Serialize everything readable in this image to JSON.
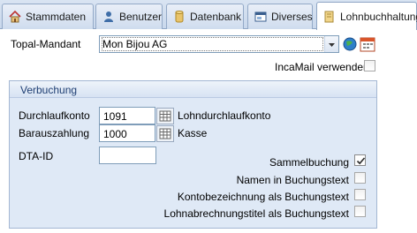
{
  "tabs": [
    {
      "label": "Stammdaten",
      "icon": "house-icon"
    },
    {
      "label": "Benutzer",
      "icon": "user-icon"
    },
    {
      "label": "Datenbank",
      "icon": "database-icon"
    },
    {
      "label": "Diverses",
      "icon": "window-icon"
    },
    {
      "label": "Lohnbuchhaltung",
      "icon": "book-icon",
      "active": true
    }
  ],
  "mandant": {
    "label": "Topal-Mandant",
    "value": "Mon Bijou AG"
  },
  "incamail": {
    "label": "IncaMail verwenden",
    "checked": false
  },
  "group": {
    "title": "Verbuchung",
    "durchlaufkonto": {
      "label": "Durchlaufkonto",
      "value": "1091",
      "description": "Lohndurchlaufkonto"
    },
    "barauszahlung": {
      "label": "Barauszahlung",
      "value": "1000",
      "description": "Kasse"
    },
    "dta_id": {
      "label": "DTA-ID",
      "value": ""
    },
    "options": [
      {
        "label": "Sammelbuchung",
        "checked": true
      },
      {
        "label": "Namen in Buchungstext",
        "checked": false
      },
      {
        "label": "Kontobezeichnung als Buchungstext",
        "checked": false
      },
      {
        "label": "Lohnabrechnungstitel als Buchungstext",
        "checked": false
      }
    ]
  },
  "colors": {
    "accent": "#1f3f73",
    "group_bg": "#dfe9f6",
    "border": "#7f9db9"
  }
}
